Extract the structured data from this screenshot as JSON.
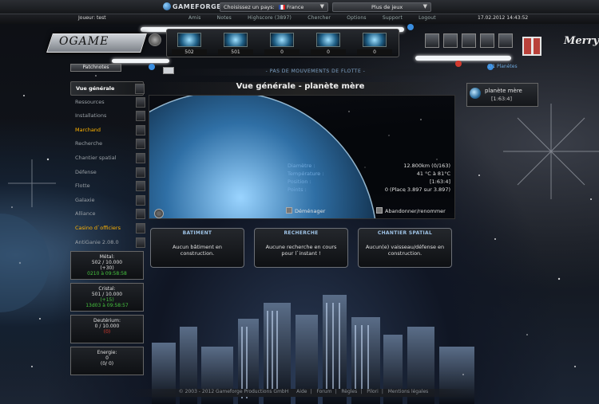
{
  "topbar": {
    "logo": "GAMEFORGE",
    "country_prompt": "Choisissez un pays:",
    "country": "France",
    "more_games": "Plus de jeux"
  },
  "header": {
    "player_label": "Joueur: test",
    "links": [
      "Amis",
      "Notes",
      "Highscore (3897)",
      "Chercher",
      "Options",
      "Support",
      "Logout"
    ],
    "datetime": "17.02.2012 14:43:52"
  },
  "logo": {
    "text": "OGAME"
  },
  "resources_bar": {
    "values": [
      "502",
      "501",
      "0",
      "0",
      "0"
    ]
  },
  "patchnotes": "Patchnotes",
  "fleet_movements": "- PAS DE MOUVEMENTS DE FLOTTE -",
  "menu": {
    "items": [
      {
        "label": "Vue générale",
        "state": "active"
      },
      {
        "label": "Ressources",
        "state": "normal"
      },
      {
        "label": "Installations",
        "state": "normal"
      },
      {
        "label": "Marchand",
        "state": "highlight"
      },
      {
        "label": "Recherche",
        "state": "normal"
      },
      {
        "label": "Chantier spatial",
        "state": "normal"
      },
      {
        "label": "Défense",
        "state": "normal"
      },
      {
        "label": "Flotte",
        "state": "normal"
      },
      {
        "label": "Galaxie",
        "state": "normal"
      },
      {
        "label": "Alliance",
        "state": "normal"
      },
      {
        "label": "Casino d`officiers",
        "state": "highlight"
      },
      {
        "label": "AntiGanie 2.08.0",
        "state": "normal"
      }
    ]
  },
  "resource_blocks": [
    {
      "title": "Métal:",
      "amount": "502 / 10.000",
      "rate": "(+30)",
      "rate_color": "green",
      "timer": "0210 à 09:58:58"
    },
    {
      "title": "Cristal:",
      "amount": "501 / 10.000",
      "rate": "(+15)",
      "rate_color": "green",
      "timer": "13d03 à 09:58:57"
    },
    {
      "title": "Deutérium:",
      "amount": "0 / 10.000",
      "rate": "(0)",
      "rate_color": "red",
      "timer": ""
    },
    {
      "title": "Energie:",
      "amount": "0",
      "rate": "(0/ 0)",
      "rate_color": "white",
      "timer": ""
    }
  ],
  "planet": {
    "title": "Vue générale - planète mère",
    "info": [
      {
        "key": "Diamètre :",
        "value": "12.800km (0/163)"
      },
      {
        "key": "Température :",
        "value": "41 °C à 81°C"
      },
      {
        "key": "Position :",
        "value": "[1:63:4]"
      },
      {
        "key": "Points :",
        "value": "0 (Place 3.897 sur 3.897)"
      }
    ],
    "move_label": "Déménager",
    "abandon_label": "Abandonner/renommer"
  },
  "production": [
    {
      "title": "BATIMENT",
      "text": "Aucun bâtiment en construction."
    },
    {
      "title": "RECHERCHE",
      "text": "Aucune recherche en cours pour l`instant !"
    },
    {
      "title": "CHANTIER SPATIAL",
      "text": "Aucun(e) vaisseau/défense en construction."
    }
  ],
  "planet_list": {
    "header": "1/1 Planètes",
    "entry_name": "planète mère",
    "entry_coords": "[1:63:4]"
  },
  "footer": {
    "copyright": "© 2003 - 2012 Gameforge Productions GmbH",
    "links": [
      "Aide",
      "Forum",
      "Règles",
      "Pilori",
      "Mentions légales"
    ]
  },
  "greeting": "Merry"
}
